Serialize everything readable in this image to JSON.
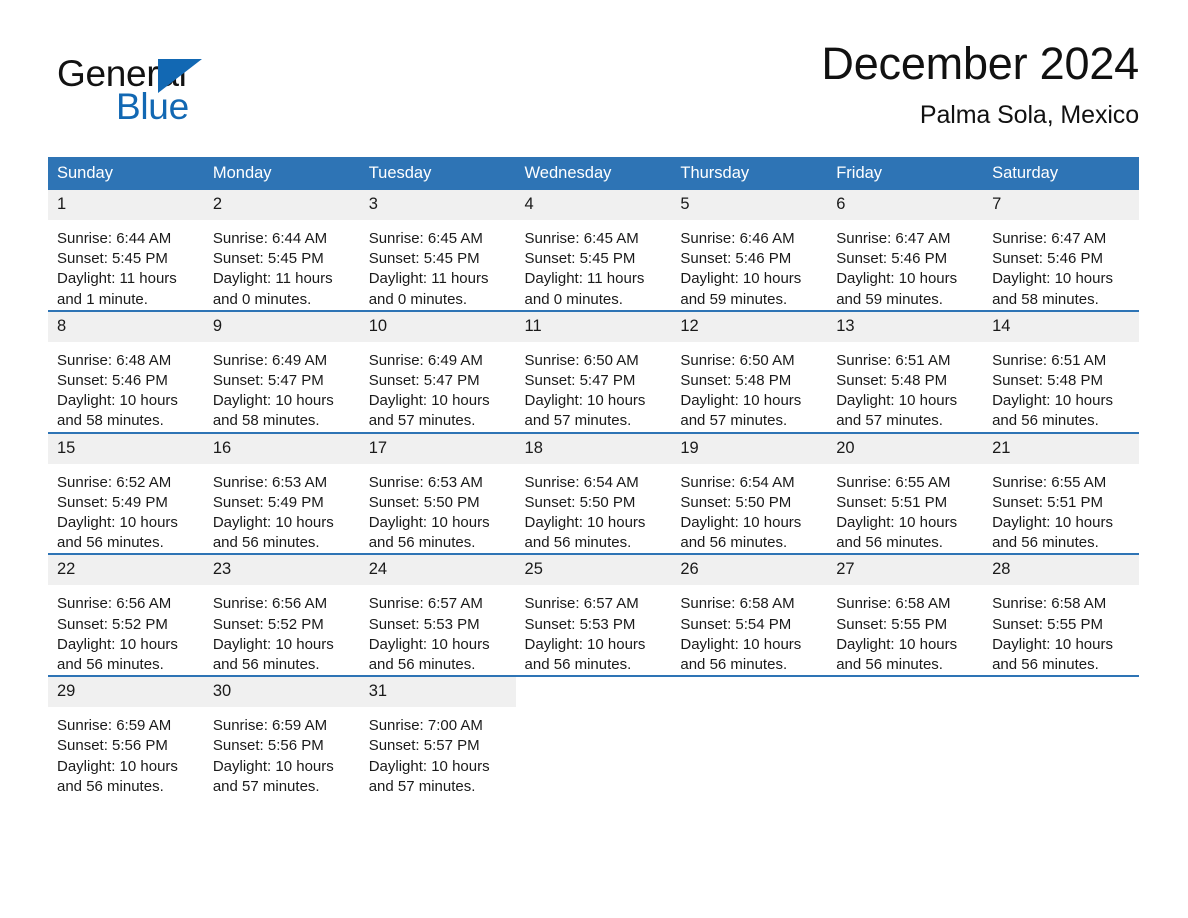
{
  "brand": {
    "name_top": "General",
    "name_bottom": "Blue",
    "triangle_icon": "blue-triangle-logo-mark",
    "color_black": "#121212",
    "color_blue": "#1268b3"
  },
  "header": {
    "title": "December 2024",
    "subtitle": "Palma Sola, Mexico"
  },
  "theme": {
    "header_blue": "#2E74B5",
    "daynum_gray": "#F0F0F0",
    "text": "#1a1a1a",
    "page_background": "#ffffff"
  },
  "calendar": {
    "weekday_headers": [
      "Sunday",
      "Monday",
      "Tuesday",
      "Wednesday",
      "Thursday",
      "Friday",
      "Saturday"
    ],
    "weeks": [
      [
        {
          "day": "1",
          "sunrise": "Sunrise: 6:44 AM",
          "sunset": "Sunset: 5:45 PM",
          "daylight_line1": "Daylight: 11 hours",
          "daylight_line2": "and 1 minute."
        },
        {
          "day": "2",
          "sunrise": "Sunrise: 6:44 AM",
          "sunset": "Sunset: 5:45 PM",
          "daylight_line1": "Daylight: 11 hours",
          "daylight_line2": "and 0 minutes."
        },
        {
          "day": "3",
          "sunrise": "Sunrise: 6:45 AM",
          "sunset": "Sunset: 5:45 PM",
          "daylight_line1": "Daylight: 11 hours",
          "daylight_line2": "and 0 minutes."
        },
        {
          "day": "4",
          "sunrise": "Sunrise: 6:45 AM",
          "sunset": "Sunset: 5:45 PM",
          "daylight_line1": "Daylight: 11 hours",
          "daylight_line2": "and 0 minutes."
        },
        {
          "day": "5",
          "sunrise": "Sunrise: 6:46 AM",
          "sunset": "Sunset: 5:46 PM",
          "daylight_line1": "Daylight: 10 hours",
          "daylight_line2": "and 59 minutes."
        },
        {
          "day": "6",
          "sunrise": "Sunrise: 6:47 AM",
          "sunset": "Sunset: 5:46 PM",
          "daylight_line1": "Daylight: 10 hours",
          "daylight_line2": "and 59 minutes."
        },
        {
          "day": "7",
          "sunrise": "Sunrise: 6:47 AM",
          "sunset": "Sunset: 5:46 PM",
          "daylight_line1": "Daylight: 10 hours",
          "daylight_line2": "and 58 minutes."
        }
      ],
      [
        {
          "day": "8",
          "sunrise": "Sunrise: 6:48 AM",
          "sunset": "Sunset: 5:46 PM",
          "daylight_line1": "Daylight: 10 hours",
          "daylight_line2": "and 58 minutes."
        },
        {
          "day": "9",
          "sunrise": "Sunrise: 6:49 AM",
          "sunset": "Sunset: 5:47 PM",
          "daylight_line1": "Daylight: 10 hours",
          "daylight_line2": "and 58 minutes."
        },
        {
          "day": "10",
          "sunrise": "Sunrise: 6:49 AM",
          "sunset": "Sunset: 5:47 PM",
          "daylight_line1": "Daylight: 10 hours",
          "daylight_line2": "and 57 minutes."
        },
        {
          "day": "11",
          "sunrise": "Sunrise: 6:50 AM",
          "sunset": "Sunset: 5:47 PM",
          "daylight_line1": "Daylight: 10 hours",
          "daylight_line2": "and 57 minutes."
        },
        {
          "day": "12",
          "sunrise": "Sunrise: 6:50 AM",
          "sunset": "Sunset: 5:48 PM",
          "daylight_line1": "Daylight: 10 hours",
          "daylight_line2": "and 57 minutes."
        },
        {
          "day": "13",
          "sunrise": "Sunrise: 6:51 AM",
          "sunset": "Sunset: 5:48 PM",
          "daylight_line1": "Daylight: 10 hours",
          "daylight_line2": "and 57 minutes."
        },
        {
          "day": "14",
          "sunrise": "Sunrise: 6:51 AM",
          "sunset": "Sunset: 5:48 PM",
          "daylight_line1": "Daylight: 10 hours",
          "daylight_line2": "and 56 minutes."
        }
      ],
      [
        {
          "day": "15",
          "sunrise": "Sunrise: 6:52 AM",
          "sunset": "Sunset: 5:49 PM",
          "daylight_line1": "Daylight: 10 hours",
          "daylight_line2": "and 56 minutes."
        },
        {
          "day": "16",
          "sunrise": "Sunrise: 6:53 AM",
          "sunset": "Sunset: 5:49 PM",
          "daylight_line1": "Daylight: 10 hours",
          "daylight_line2": "and 56 minutes."
        },
        {
          "day": "17",
          "sunrise": "Sunrise: 6:53 AM",
          "sunset": "Sunset: 5:50 PM",
          "daylight_line1": "Daylight: 10 hours",
          "daylight_line2": "and 56 minutes."
        },
        {
          "day": "18",
          "sunrise": "Sunrise: 6:54 AM",
          "sunset": "Sunset: 5:50 PM",
          "daylight_line1": "Daylight: 10 hours",
          "daylight_line2": "and 56 minutes."
        },
        {
          "day": "19",
          "sunrise": "Sunrise: 6:54 AM",
          "sunset": "Sunset: 5:50 PM",
          "daylight_line1": "Daylight: 10 hours",
          "daylight_line2": "and 56 minutes."
        },
        {
          "day": "20",
          "sunrise": "Sunrise: 6:55 AM",
          "sunset": "Sunset: 5:51 PM",
          "daylight_line1": "Daylight: 10 hours",
          "daylight_line2": "and 56 minutes."
        },
        {
          "day": "21",
          "sunrise": "Sunrise: 6:55 AM",
          "sunset": "Sunset: 5:51 PM",
          "daylight_line1": "Daylight: 10 hours",
          "daylight_line2": "and 56 minutes."
        }
      ],
      [
        {
          "day": "22",
          "sunrise": "Sunrise: 6:56 AM",
          "sunset": "Sunset: 5:52 PM",
          "daylight_line1": "Daylight: 10 hours",
          "daylight_line2": "and 56 minutes."
        },
        {
          "day": "23",
          "sunrise": "Sunrise: 6:56 AM",
          "sunset": "Sunset: 5:52 PM",
          "daylight_line1": "Daylight: 10 hours",
          "daylight_line2": "and 56 minutes."
        },
        {
          "day": "24",
          "sunrise": "Sunrise: 6:57 AM",
          "sunset": "Sunset: 5:53 PM",
          "daylight_line1": "Daylight: 10 hours",
          "daylight_line2": "and 56 minutes."
        },
        {
          "day": "25",
          "sunrise": "Sunrise: 6:57 AM",
          "sunset": "Sunset: 5:53 PM",
          "daylight_line1": "Daylight: 10 hours",
          "daylight_line2": "and 56 minutes."
        },
        {
          "day": "26",
          "sunrise": "Sunrise: 6:58 AM",
          "sunset": "Sunset: 5:54 PM",
          "daylight_line1": "Daylight: 10 hours",
          "daylight_line2": "and 56 minutes."
        },
        {
          "day": "27",
          "sunrise": "Sunrise: 6:58 AM",
          "sunset": "Sunset: 5:55 PM",
          "daylight_line1": "Daylight: 10 hours",
          "daylight_line2": "and 56 minutes."
        },
        {
          "day": "28",
          "sunrise": "Sunrise: 6:58 AM",
          "sunset": "Sunset: 5:55 PM",
          "daylight_line1": "Daylight: 10 hours",
          "daylight_line2": "and 56 minutes."
        }
      ],
      [
        {
          "day": "29",
          "sunrise": "Sunrise: 6:59 AM",
          "sunset": "Sunset: 5:56 PM",
          "daylight_line1": "Daylight: 10 hours",
          "daylight_line2": "and 56 minutes."
        },
        {
          "day": "30",
          "sunrise": "Sunrise: 6:59 AM",
          "sunset": "Sunset: 5:56 PM",
          "daylight_line1": "Daylight: 10 hours",
          "daylight_line2": "and 57 minutes."
        },
        {
          "day": "31",
          "sunrise": "Sunrise: 7:00 AM",
          "sunset": "Sunset: 5:57 PM",
          "daylight_line1": "Daylight: 10 hours",
          "daylight_line2": "and 57 minutes."
        },
        {
          "day": "",
          "sunrise": "",
          "sunset": "",
          "daylight_line1": "",
          "daylight_line2": ""
        },
        {
          "day": "",
          "sunrise": "",
          "sunset": "",
          "daylight_line1": "",
          "daylight_line2": ""
        },
        {
          "day": "",
          "sunrise": "",
          "sunset": "",
          "daylight_line1": "",
          "daylight_line2": ""
        },
        {
          "day": "",
          "sunrise": "",
          "sunset": "",
          "daylight_line1": "",
          "daylight_line2": ""
        }
      ]
    ]
  }
}
